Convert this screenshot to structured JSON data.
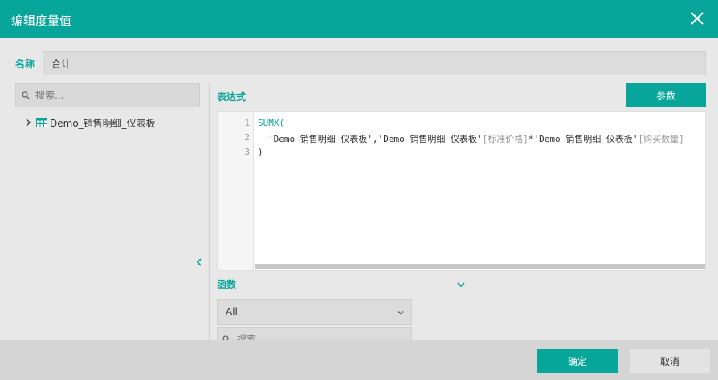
{
  "dialog": {
    "title": "编辑度量值",
    "close_icon": "close-icon"
  },
  "name_field": {
    "label": "名称",
    "value": "合计"
  },
  "left_panel": {
    "search_placeholder": "搜索...",
    "tree_items": [
      {
        "label": "Demo_销售明细_仪表板",
        "icon": "table-icon",
        "expand_icon": "chevron-right-icon"
      }
    ],
    "collapse_icon": "chevron-left-icon"
  },
  "expression": {
    "label": "表达式",
    "params_button": "参数",
    "line_numbers": [
      "1",
      "2",
      "3"
    ],
    "lines": {
      "l1_func": "SUMX(",
      "l2_part1": "'Demo_销售明细_仪表板','Demo_销售明细_仪表板'",
      "l2_col1": "[标准价格]",
      "l2_op": "*'Demo_销售明细_仪表板'",
      "l2_col2": "[购买数量]",
      "l3": ")"
    }
  },
  "functions": {
    "label": "函数",
    "toggle_icon": "chevron-down-icon",
    "select_value": "All",
    "search_placeholder": "搜索"
  },
  "footer": {
    "ok_button": "确定",
    "cancel_button": "取消"
  },
  "colors": {
    "accent": "#08a69a",
    "background": "#e8e8e8",
    "footer": "#d5d5d5"
  }
}
